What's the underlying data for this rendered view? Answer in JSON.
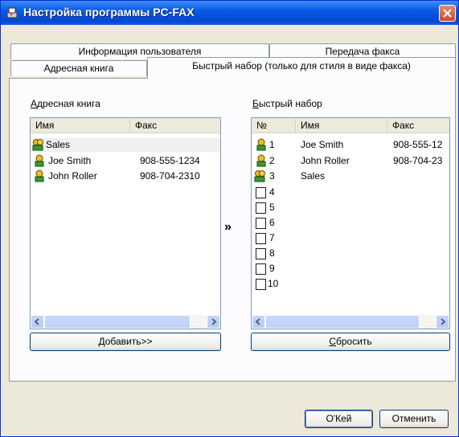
{
  "window": {
    "title": "Настройка программы PC-FAX"
  },
  "tabs": [
    {
      "label": "Информация пользователя"
    },
    {
      "label": "Передача факса"
    },
    {
      "label": "Адресная книга"
    },
    {
      "label": "Быстрый набор (только для стиля в виде факса)"
    }
  ],
  "address_book": {
    "label_first": "А",
    "label_rest": "дресная книга",
    "columns": {
      "name": "Имя",
      "fax": "Факс"
    },
    "rows": [
      {
        "name": "Sales",
        "fax": "",
        "icon": "group-contact-icon"
      },
      {
        "name": "Joe Smith",
        "fax": "908-555-1234",
        "icon": "contact-icon"
      },
      {
        "name": "John Roller",
        "fax": "908-704-2310",
        "icon": "contact-icon"
      }
    ],
    "add_button_first": "Д",
    "add_button_rest": "обавить>>"
  },
  "arrow_label": "»",
  "speed_dial": {
    "label_first": "Б",
    "label_rest": "ыстрый набор",
    "columns": {
      "num": "№",
      "name": "Имя",
      "fax": "Факс"
    },
    "rows": [
      {
        "num": "1",
        "name": "Joe Smith",
        "fax": "908-555-12",
        "icon": "contact-icon"
      },
      {
        "num": "2",
        "name": "John Roller",
        "fax": "908-704-23",
        "icon": "contact-icon"
      },
      {
        "num": "3",
        "name": "Sales",
        "fax": "",
        "icon": "group-contact-icon"
      },
      {
        "num": "4",
        "name": "",
        "fax": "",
        "icon": ""
      },
      {
        "num": "5",
        "name": "",
        "fax": "",
        "icon": ""
      },
      {
        "num": "6",
        "name": "",
        "fax": "",
        "icon": ""
      },
      {
        "num": "7",
        "name": "",
        "fax": "",
        "icon": ""
      },
      {
        "num": "8",
        "name": "",
        "fax": "",
        "icon": ""
      },
      {
        "num": "9",
        "name": "",
        "fax": "",
        "icon": ""
      },
      {
        "num": "10",
        "name": "",
        "fax": "",
        "icon": ""
      }
    ],
    "reset_button_first": "С",
    "reset_button_rest": "бросить"
  },
  "footer": {
    "ok_label": "O'Кей",
    "cancel_label": "Отменить"
  },
  "colors": {
    "titlebar": "#0a5ae6",
    "dialog_bg": "#ece9d8",
    "close": "#c94b2a"
  }
}
